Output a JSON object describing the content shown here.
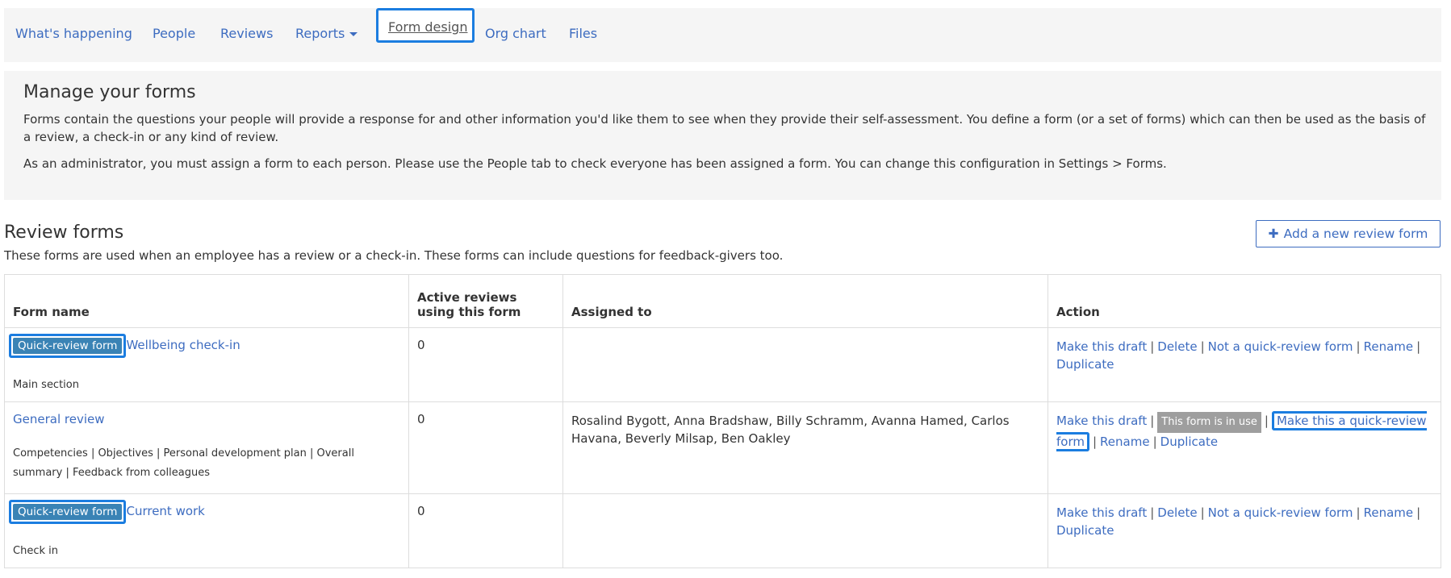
{
  "nav": {
    "items": [
      "What's happening",
      "People",
      "Reviews",
      "Reports",
      "Form design",
      "Org chart",
      "Files"
    ],
    "active": "Form design"
  },
  "intro": {
    "title": "Manage your forms",
    "p1": "Forms contain the questions your people will provide a response for and other information you'd like them to see when they provide their self-assessment. You define a form (or a set of forms) which can then be used as the basis of a review, a check-in or any kind of review.",
    "p2": "As an administrator, you must assign a form to each person. Please use the People tab to check everyone has been assigned a form. You can change this configuration in Settings > Forms."
  },
  "review_forms": {
    "title": "Review forms",
    "description": "These forms are used when an employee has a review or a check-in. These forms can include questions for feedback-givers too.",
    "add_button": "Add a new review form",
    "add_icon": "plus-icon"
  },
  "table": {
    "headers": [
      "Form name",
      "Active reviews using this form",
      "Assigned to",
      "Action"
    ],
    "rows": [
      {
        "badge": "Quick-review form",
        "name": "Wellbeing check-in",
        "sections": "Main section",
        "active": "0",
        "assigned": "",
        "actions": [
          "Make this draft",
          "Delete",
          "Not a quick-review form",
          "Rename",
          "Duplicate"
        ]
      },
      {
        "badge": "",
        "name": "General review",
        "sections": "Competencies | Objectives | Personal development plan | Overall summary | Feedback from colleagues",
        "active": "0",
        "assigned": "Rosalind Bygott, Anna Bradshaw, Billy Schramm, Avanna Hamed, Carlos Havana, Beverly Milsap, Ben Oakley",
        "in_use": "This form is in use",
        "actions": [
          "Make this draft",
          "Make this a quick-review form",
          "Rename",
          "Duplicate"
        ]
      },
      {
        "badge": "Quick-review form",
        "name": "Current work",
        "sections": "Check in",
        "active": "0",
        "assigned": "",
        "actions": [
          "Make this draft",
          "Delete",
          "Not a quick-review form",
          "Rename",
          "Duplicate"
        ]
      }
    ]
  }
}
